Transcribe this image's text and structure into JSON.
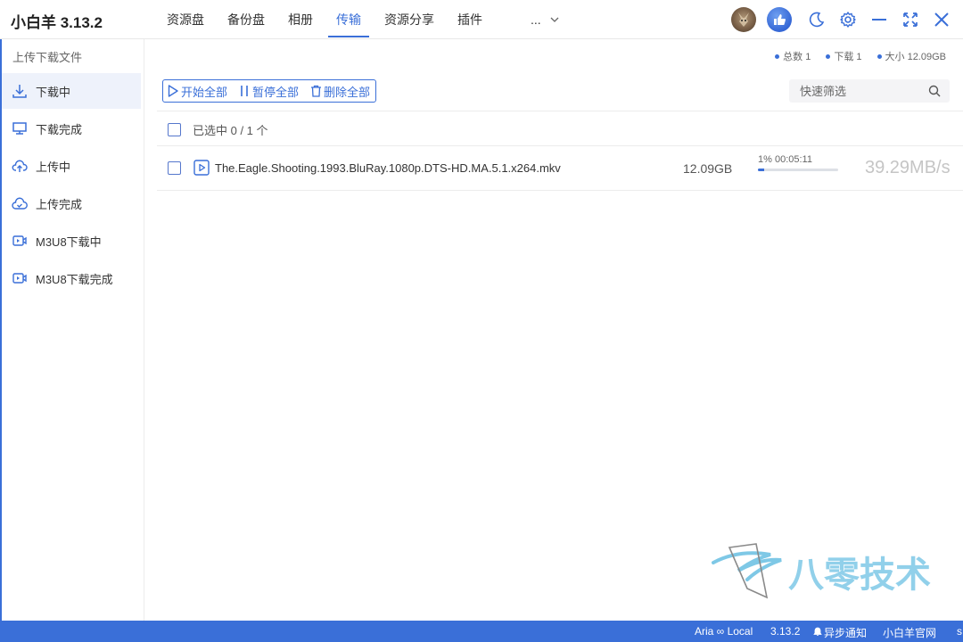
{
  "app": {
    "title": "小白羊 3.13.2"
  },
  "nav": {
    "tabs": [
      {
        "label": "资源盘"
      },
      {
        "label": "备份盘"
      },
      {
        "label": "相册"
      },
      {
        "label": "传输"
      },
      {
        "label": "资源分享"
      },
      {
        "label": "插件"
      }
    ],
    "more_label": "...",
    "active_tab": "传输"
  },
  "sidebar": {
    "header": "上传下载文件",
    "items": [
      {
        "label": "下载中",
        "icon": "download-icon"
      },
      {
        "label": "下载完成",
        "icon": "monitor-icon"
      },
      {
        "label": "上传中",
        "icon": "cloud-upload-icon"
      },
      {
        "label": "上传完成",
        "icon": "cloud-check-icon"
      },
      {
        "label": "M3U8下载中",
        "icon": "video-icon"
      },
      {
        "label": "M3U8下载完成",
        "icon": "video-icon"
      }
    ]
  },
  "stats": {
    "total": "总数 1",
    "download": "下载 1",
    "size": "大小 12.09GB"
  },
  "actions": {
    "start_all": "开始全部",
    "pause_all": "暂停全部",
    "delete_all": "删除全部"
  },
  "filter": {
    "placeholder": "快速筛选"
  },
  "selection": {
    "label": "已选中 0 / 1 个"
  },
  "files": [
    {
      "name": "The.Eagle.Shooting.1993.BluRay.1080p.DTS-HD.MA.5.1.x264.mkv",
      "size": "12.09GB",
      "progress_text": "1% 00:05:11",
      "progress": 0.01,
      "speed": "39.29MB/s"
    }
  ],
  "watermark": {
    "text": "八零技术"
  },
  "statusbar": {
    "aria": "Aria ∞ Local",
    "version": "3.13.2",
    "notify": "异步通知",
    "website": "小白羊官网",
    "edge": "s"
  },
  "colors": {
    "accent": "#3a6fd8",
    "statusbar": "#3a6fd8",
    "watermark": "#7ec8e6"
  }
}
